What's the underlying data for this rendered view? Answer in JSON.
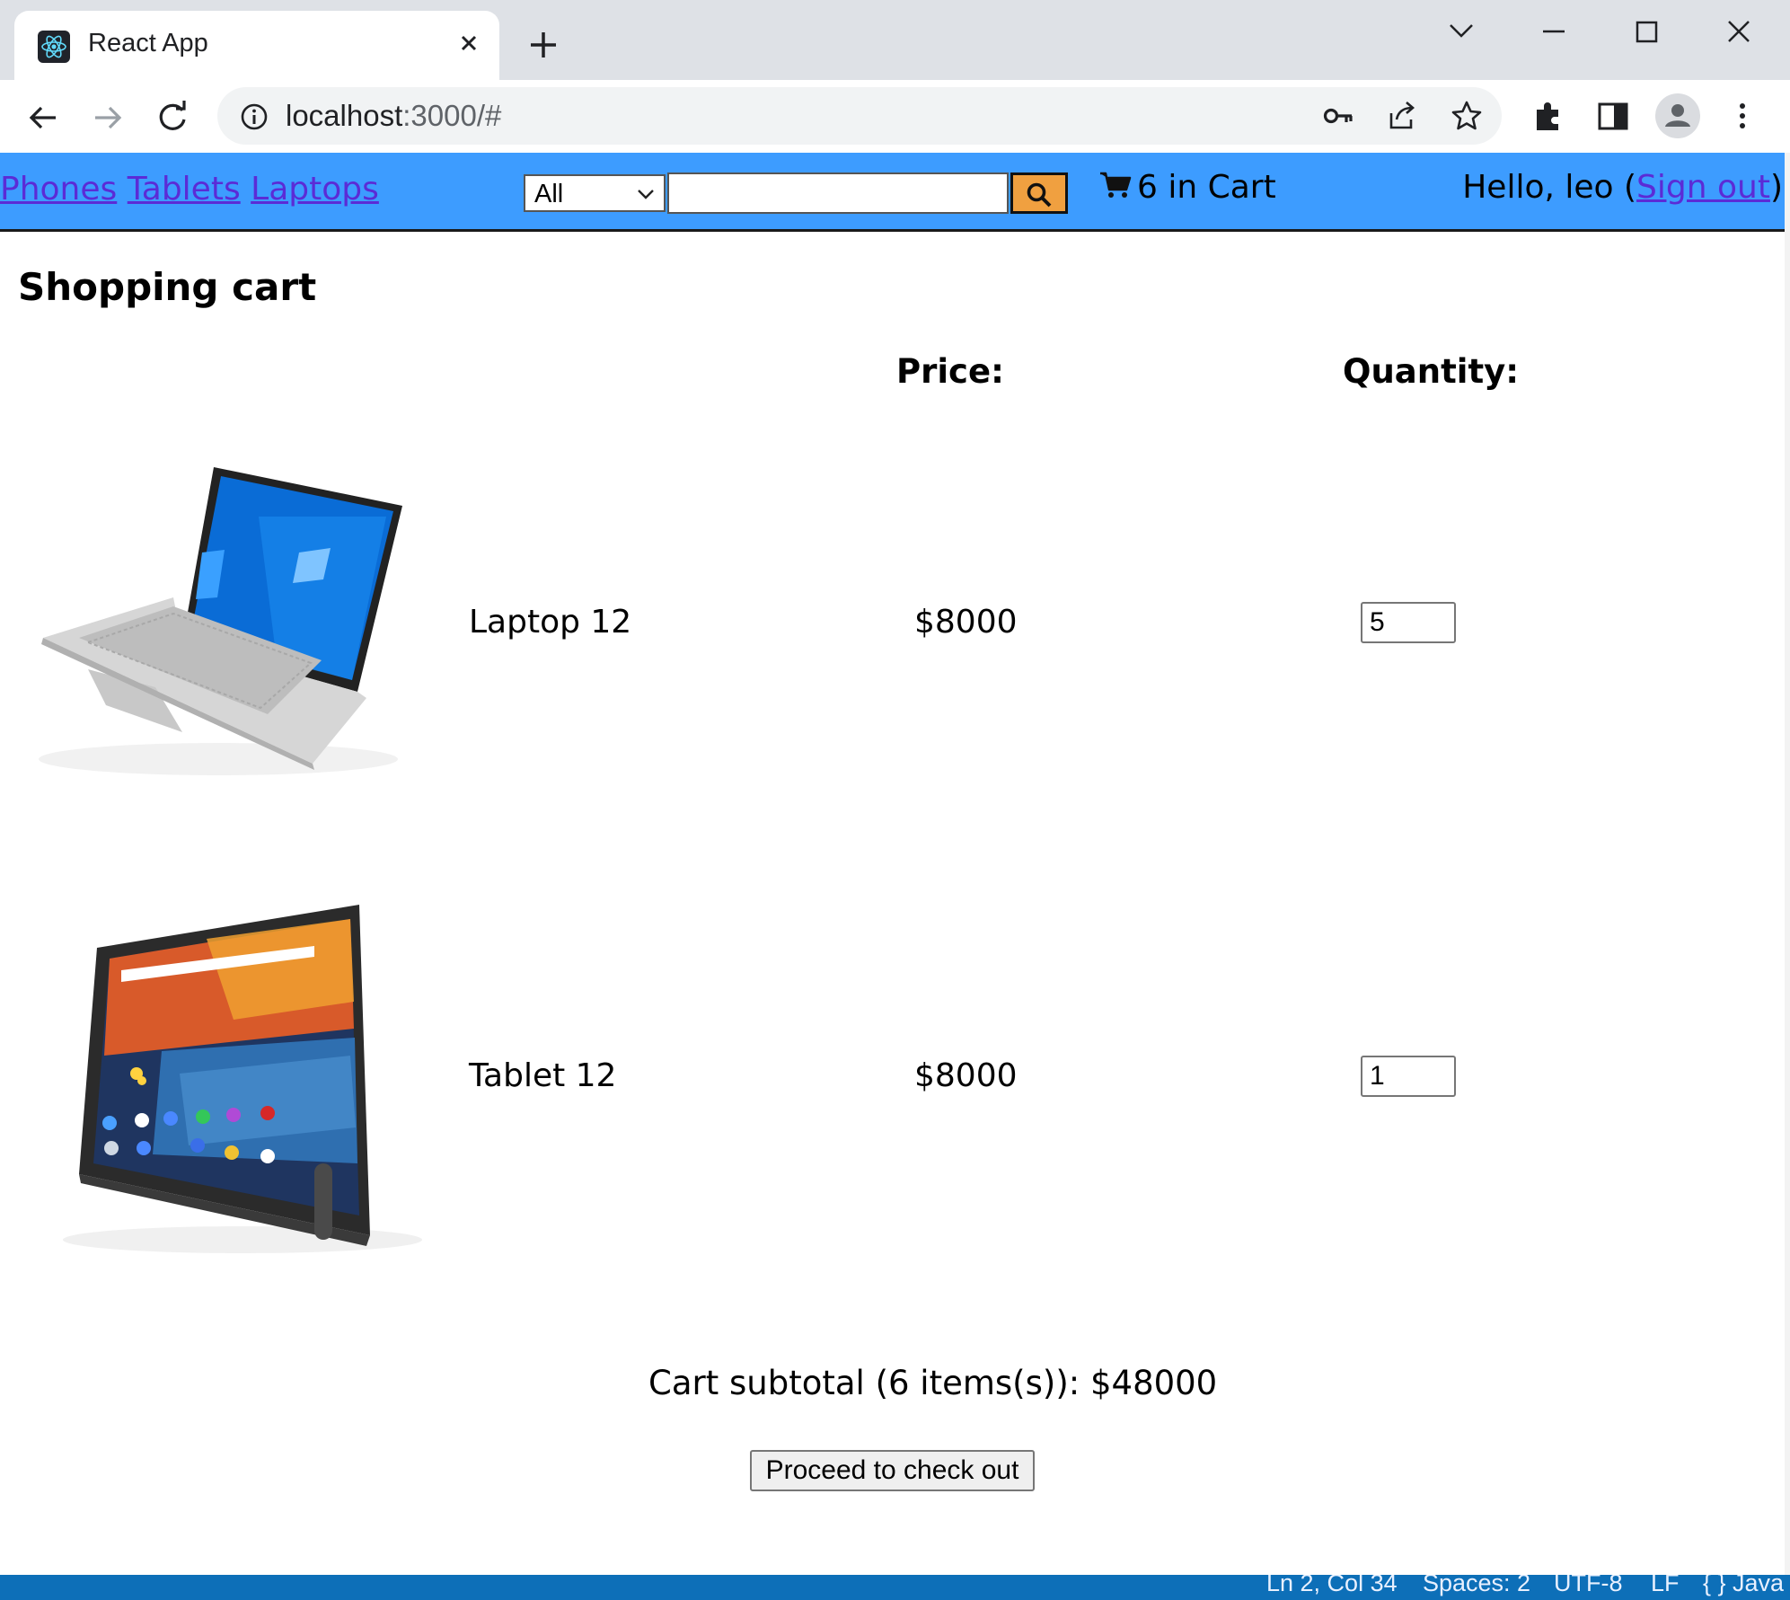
{
  "browser": {
    "tab_title": "React App",
    "url_host": "localhost",
    "url_rest": ":3000/#"
  },
  "nav": {
    "links": [
      "Phones",
      "Tablets",
      "Laptops"
    ],
    "category_selected": "All",
    "search_value": "",
    "cart_count_text": "6 in Cart",
    "greeting_prefix": "Hello, leo (",
    "sign_out": "Sign out",
    "greeting_suffix": ")"
  },
  "cart": {
    "title": "Shopping cart",
    "price_header": "Price:",
    "quantity_header": "Quantity:",
    "items": [
      {
        "name": "Laptop 12",
        "price": "$8000",
        "quantity": "5",
        "image": "laptop-image"
      },
      {
        "name": "Tablet 12",
        "price": "$8000",
        "quantity": "1",
        "image": "tablet-image"
      }
    ],
    "subtotal": "Cart subtotal (6 items(s)): $48000",
    "checkout_label": "Proceed to check out"
  },
  "status_bar": {
    "position": "Ln 2, Col 34",
    "spaces": "Spaces: 2",
    "encoding": "UTF-8",
    "eol": "LF",
    "language": "{ } Java"
  },
  "colors": {
    "nav_bg": "#3d9cff",
    "link": "#5b2bd6",
    "search_button": "#f0a040",
    "status_bar": "#0d6fb8"
  }
}
